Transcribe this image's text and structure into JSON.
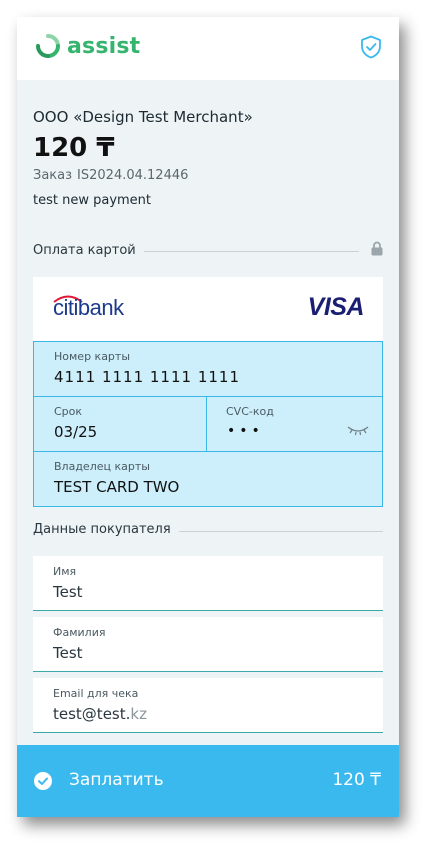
{
  "header": {
    "logo_text": "assist",
    "shield_icon": "shield-check-icon"
  },
  "order": {
    "merchant": "ООО «Design Test Merchant»",
    "amount": "120 ₸",
    "order_label": "Заказ",
    "order_number": "IS2024.04.12446",
    "description": "test new payment"
  },
  "card_section": {
    "title": "Оплата картой",
    "lock_icon": "lock-icon",
    "bank": "citibank",
    "network": "VISA",
    "number_label": "Номер карты",
    "number_value": "4111 1111 1111 1111",
    "expiry_label": "Срок",
    "expiry_value": "03/25",
    "cvc_label": "CVC-код",
    "cvc_value": "•••",
    "holder_label": "Владелец карты",
    "holder_value": "TEST CARD TWO"
  },
  "buyer_section": {
    "title": "Данные покупателя",
    "first_name_label": "Имя",
    "first_name_value": "Test",
    "last_name_label": "Фамилия",
    "last_name_value": "Test",
    "email_label": "Email для чека",
    "email_value": "test@test.",
    "email_domain": "kz"
  },
  "pay_button": {
    "label": "Заплатить",
    "amount": "120 ₸",
    "icon": "check-circle-icon"
  },
  "colors": {
    "brand_green": "#35b46e",
    "accent_blue": "#3ab9ee",
    "field_bg": "#cdeffb",
    "field_border": "#3ab7e6",
    "visa_navy": "#1a1f71",
    "citi_blue": "#1d3b8c",
    "citi_red": "#e31837"
  }
}
